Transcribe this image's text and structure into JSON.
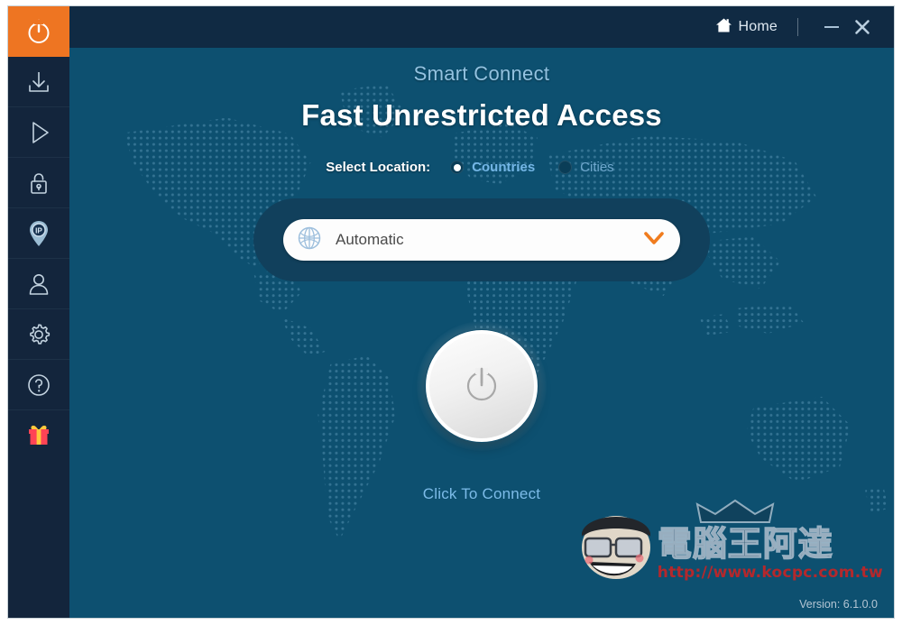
{
  "window": {
    "accent_orange": "#ee7522",
    "titlebar_bg": "#102a43",
    "content_bg": "#0d5070",
    "version_text": "Version: 6.1.0.0"
  },
  "titlebar": {
    "home_label": "Home",
    "home_icon": "home-icon",
    "minimize_icon": "minimize-icon",
    "close_icon": "close-icon"
  },
  "sidebar": {
    "items": [
      {
        "name": "power",
        "icon": "power-icon",
        "active": true
      },
      {
        "name": "download",
        "icon": "download-icon",
        "active": false
      },
      {
        "name": "play",
        "icon": "play-icon",
        "active": false
      },
      {
        "name": "lock",
        "icon": "lock-icon",
        "active": false
      },
      {
        "name": "ip",
        "icon": "ip-pin-icon",
        "active": false
      },
      {
        "name": "account",
        "icon": "user-icon",
        "active": false
      },
      {
        "name": "settings",
        "icon": "gear-icon",
        "active": false
      },
      {
        "name": "help",
        "icon": "question-circle-icon",
        "active": false
      },
      {
        "name": "gift",
        "icon": "gift-icon",
        "active": false
      }
    ]
  },
  "main": {
    "smart_connect": "Smart Connect",
    "headline": "Fast Unrestricted Access",
    "select_location_label": "Select Location:",
    "location_options": [
      {
        "label": "Countries",
        "selected": true
      },
      {
        "label": "Cities",
        "selected": false
      }
    ],
    "dropdown": {
      "value": "Automatic",
      "globe_icon": "globe-icon",
      "chevron_icon": "chevron-down-icon",
      "chevron_color": "#f07c1e"
    },
    "power_button": {
      "icon": "power-icon",
      "state_label": "Click To Connect"
    }
  },
  "watermark": {
    "title": "電腦王阿達",
    "url": "http://www.kocpc.com.tw"
  }
}
